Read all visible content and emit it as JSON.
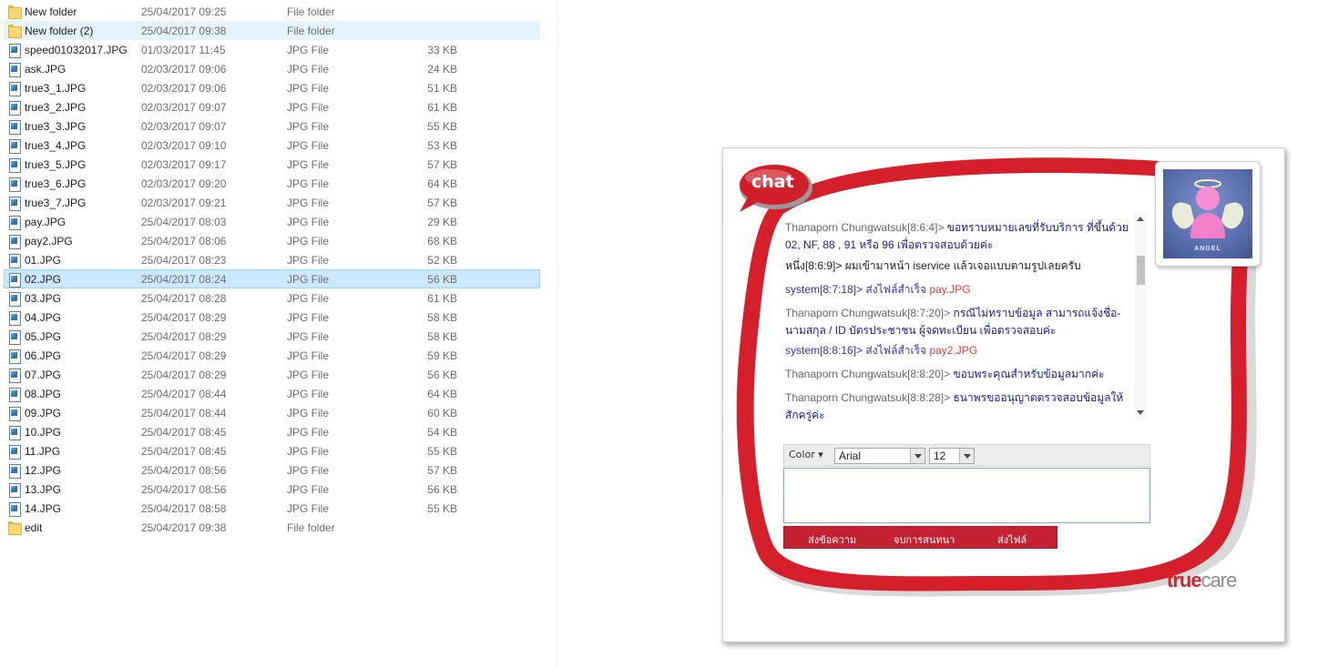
{
  "files": [
    {
      "name": "New folder",
      "date": "25/04/2017 09:25",
      "type": "File folder",
      "size": "",
      "icon": "folder-icon",
      "state": ""
    },
    {
      "name": "New folder (2)",
      "date": "25/04/2017 09:38",
      "type": "File folder",
      "size": "",
      "icon": "folder-icon",
      "state": "hover"
    },
    {
      "name": "speed01032017.JPG",
      "date": "01/03/2017 11:45",
      "type": "JPG File",
      "size": "33 KB",
      "icon": "image-icon",
      "state": ""
    },
    {
      "name": "ask.JPG",
      "date": "02/03/2017 09:06",
      "type": "JPG File",
      "size": "24 KB",
      "icon": "image-icon",
      "state": ""
    },
    {
      "name": "true3_1.JPG",
      "date": "02/03/2017 09:06",
      "type": "JPG File",
      "size": "51 KB",
      "icon": "image-icon",
      "state": ""
    },
    {
      "name": "true3_2.JPG",
      "date": "02/03/2017 09:07",
      "type": "JPG File",
      "size": "61 KB",
      "icon": "image-icon",
      "state": ""
    },
    {
      "name": "true3_3.JPG",
      "date": "02/03/2017 09:07",
      "type": "JPG File",
      "size": "55 KB",
      "icon": "image-icon",
      "state": ""
    },
    {
      "name": "true3_4.JPG",
      "date": "02/03/2017 09:10",
      "type": "JPG File",
      "size": "53 KB",
      "icon": "image-icon",
      "state": ""
    },
    {
      "name": "true3_5.JPG",
      "date": "02/03/2017 09:17",
      "type": "JPG File",
      "size": "57 KB",
      "icon": "image-icon",
      "state": ""
    },
    {
      "name": "true3_6.JPG",
      "date": "02/03/2017 09:20",
      "type": "JPG File",
      "size": "64 KB",
      "icon": "image-icon",
      "state": ""
    },
    {
      "name": "true3_7.JPG",
      "date": "02/03/2017 09:21",
      "type": "JPG File",
      "size": "57 KB",
      "icon": "image-icon",
      "state": ""
    },
    {
      "name": "pay.JPG",
      "date": "25/04/2017 08:03",
      "type": "JPG File",
      "size": "29 KB",
      "icon": "image-icon",
      "state": ""
    },
    {
      "name": "pay2.JPG",
      "date": "25/04/2017 08:06",
      "type": "JPG File",
      "size": "68 KB",
      "icon": "image-icon",
      "state": ""
    },
    {
      "name": "01.JPG",
      "date": "25/04/2017 08:23",
      "type": "JPG File",
      "size": "52 KB",
      "icon": "image-icon",
      "state": ""
    },
    {
      "name": "02.JPG",
      "date": "25/04/2017 08:24",
      "type": "JPG File",
      "size": "56 KB",
      "icon": "image-icon",
      "state": "selected"
    },
    {
      "name": "03.JPG",
      "date": "25/04/2017 08:28",
      "type": "JPG File",
      "size": "61 KB",
      "icon": "image-icon",
      "state": ""
    },
    {
      "name": "04.JPG",
      "date": "25/04/2017 08:29",
      "type": "JPG File",
      "size": "58 KB",
      "icon": "image-icon",
      "state": ""
    },
    {
      "name": "05.JPG",
      "date": "25/04/2017 08:29",
      "type": "JPG File",
      "size": "58 KB",
      "icon": "image-icon",
      "state": ""
    },
    {
      "name": "06.JPG",
      "date": "25/04/2017 08:29",
      "type": "JPG File",
      "size": "59 KB",
      "icon": "image-icon",
      "state": ""
    },
    {
      "name": "07.JPG",
      "date": "25/04/2017 08:29",
      "type": "JPG File",
      "size": "56 KB",
      "icon": "image-icon",
      "state": ""
    },
    {
      "name": "08.JPG",
      "date": "25/04/2017 08:44",
      "type": "JPG File",
      "size": "64 KB",
      "icon": "image-icon",
      "state": ""
    },
    {
      "name": "09.JPG",
      "date": "25/04/2017 08:44",
      "type": "JPG File",
      "size": "60 KB",
      "icon": "image-icon",
      "state": ""
    },
    {
      "name": "10.JPG",
      "date": "25/04/2017 08:45",
      "type": "JPG File",
      "size": "54 KB",
      "icon": "image-icon",
      "state": ""
    },
    {
      "name": "11.JPG",
      "date": "25/04/2017 08:45",
      "type": "JPG File",
      "size": "55 KB",
      "icon": "image-icon",
      "state": ""
    },
    {
      "name": "12.JPG",
      "date": "25/04/2017 08:56",
      "type": "JPG File",
      "size": "57 KB",
      "icon": "image-icon",
      "state": ""
    },
    {
      "name": "13.JPG",
      "date": "25/04/2017 08:56",
      "type": "JPG File",
      "size": "56 KB",
      "icon": "image-icon",
      "state": ""
    },
    {
      "name": "14.JPG",
      "date": "25/04/2017 08:58",
      "type": "JPG File",
      "size": "55 KB",
      "icon": "image-icon",
      "state": ""
    },
    {
      "name": "edit",
      "date": "25/04/2017 09:38",
      "type": "File folder",
      "size": "",
      "icon": "folder-icon",
      "state": ""
    }
  ],
  "chat": {
    "logo_text": "chat",
    "avatar_label": "ANGEL",
    "messages": [
      {
        "sender": "Thanaporn Chungwatsuk[8:6:4]>",
        "sender_style": "gray",
        "text": "ขอทราบหมายเลขที่รับบริการ ที่ขึ้นด้วย 02, NF, 88 , 91 หรือ 96 เพื่อตรวจสอบด้วยค่ะ",
        "attachment": ""
      },
      {
        "sender": "หนึ่ง[8:6:9]>",
        "sender_style": "dark",
        "text": "ผมเข้ามาหน้า iservice แล้วเจอแบบตามรูปเลยครับ",
        "attachment": ""
      },
      {
        "sender": "system[8:7:18]>",
        "sender_style": "blue",
        "text": "ส่งไฟล์สำเร็จ",
        "attachment": "pay.JPG"
      },
      {
        "sender": "Thanaporn Chungwatsuk[8:7:20]>",
        "sender_style": "gray",
        "text": "กรณีไม่ทราบข้อมูล สามารถแจ้งชื่อ-นามสกุล / ID บัตรประชาชน ผู้จดทะเบียน เพื่อตรวจสอบค่ะ",
        "attachment": ""
      },
      {
        "sender": "system[8:8:16]>",
        "sender_style": "blue",
        "text": "ส่งไฟล์สำเร็จ",
        "attachment": "pay2.JPG"
      },
      {
        "sender": "Thanaporn Chungwatsuk[8:8:20]>",
        "sender_style": "gray",
        "text": "ขอบพระคุณสำหรับข้อมูลมากค่ะ",
        "attachment": ""
      },
      {
        "sender": "Thanaporn Chungwatsuk[8:8:28]>",
        "sender_style": "gray",
        "text": "ธนาพรขออนุญาตตรวจสอบข้อมูลให้สักครู่ค่ะ",
        "attachment": ""
      }
    ],
    "toolbar": {
      "color_label": "Color ▾",
      "font_value": "Arial",
      "size_value": "12"
    },
    "input_value": "",
    "actions": {
      "send_message": "ส่งข้อความ",
      "end_chat": "จบการสนทนา",
      "send_file": "ส่งไฟล์"
    },
    "brand": {
      "true": "true",
      "care": "care"
    },
    "colors": {
      "brand_red": "#c42233",
      "message_blue": "#1a1a9a",
      "attachment_red": "#e23b3b"
    }
  }
}
